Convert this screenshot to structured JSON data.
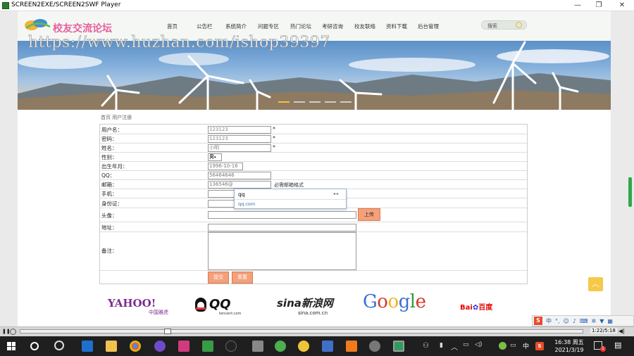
{
  "window": {
    "title": "SCREEN2EXE/SCREEN2SWF Player"
  },
  "site": {
    "logo_text": "校友交流论坛",
    "nav": [
      "首页",
      "公告栏",
      "系统简介",
      "问题专区",
      "热门论坛",
      "考研咨询",
      "校友联络",
      "资料下载",
      "后台管理"
    ],
    "search_placeholder": "搜索",
    "watermark": "https://www.huzhan.com/ishop39397"
  },
  "breadcrumb": "首页 用户注册",
  "form": {
    "labels": {
      "username": "用户名：",
      "password": "密码：",
      "realname": "姓名：",
      "gender": "性别：",
      "birthday": "出生年月：",
      "qq": "QQ：",
      "email": "邮箱：",
      "phone": "手机：",
      "idcard": "身份证：",
      "avatar": "头像：",
      "address": "地址：",
      "remark": "备注："
    },
    "values": {
      "username": "123123",
      "password": "123123",
      "realname": "小明",
      "gender": "男",
      "birthday": "1996-10-16",
      "qq": "56464646",
      "email": "136546@"
    },
    "required_mark": "*",
    "email_hint": "必需邮箱格式",
    "upload_label": "上传",
    "submit_label": "提交",
    "reset_label": "重置"
  },
  "autocomplete": {
    "query": "qq",
    "arrows": "◂ ▸",
    "option": "qq.com"
  },
  "partners": [
    "YAHOO!",
    "中国雅虎",
    "QQ",
    "tencent.com",
    "sina新浪网",
    "sina.com.cn",
    "Google",
    "Bai",
    "百度"
  ],
  "player": {
    "time": "1:22/5:18"
  },
  "taskbar": {
    "time": "16:38 周五",
    "date": "2021/3/19",
    "ime_label": "中",
    "notification_count": "1"
  },
  "colors": {
    "accent_orange": "#f5a07a",
    "logo_pink": "#e55f9e",
    "taskbar": "#1f1f1f"
  }
}
